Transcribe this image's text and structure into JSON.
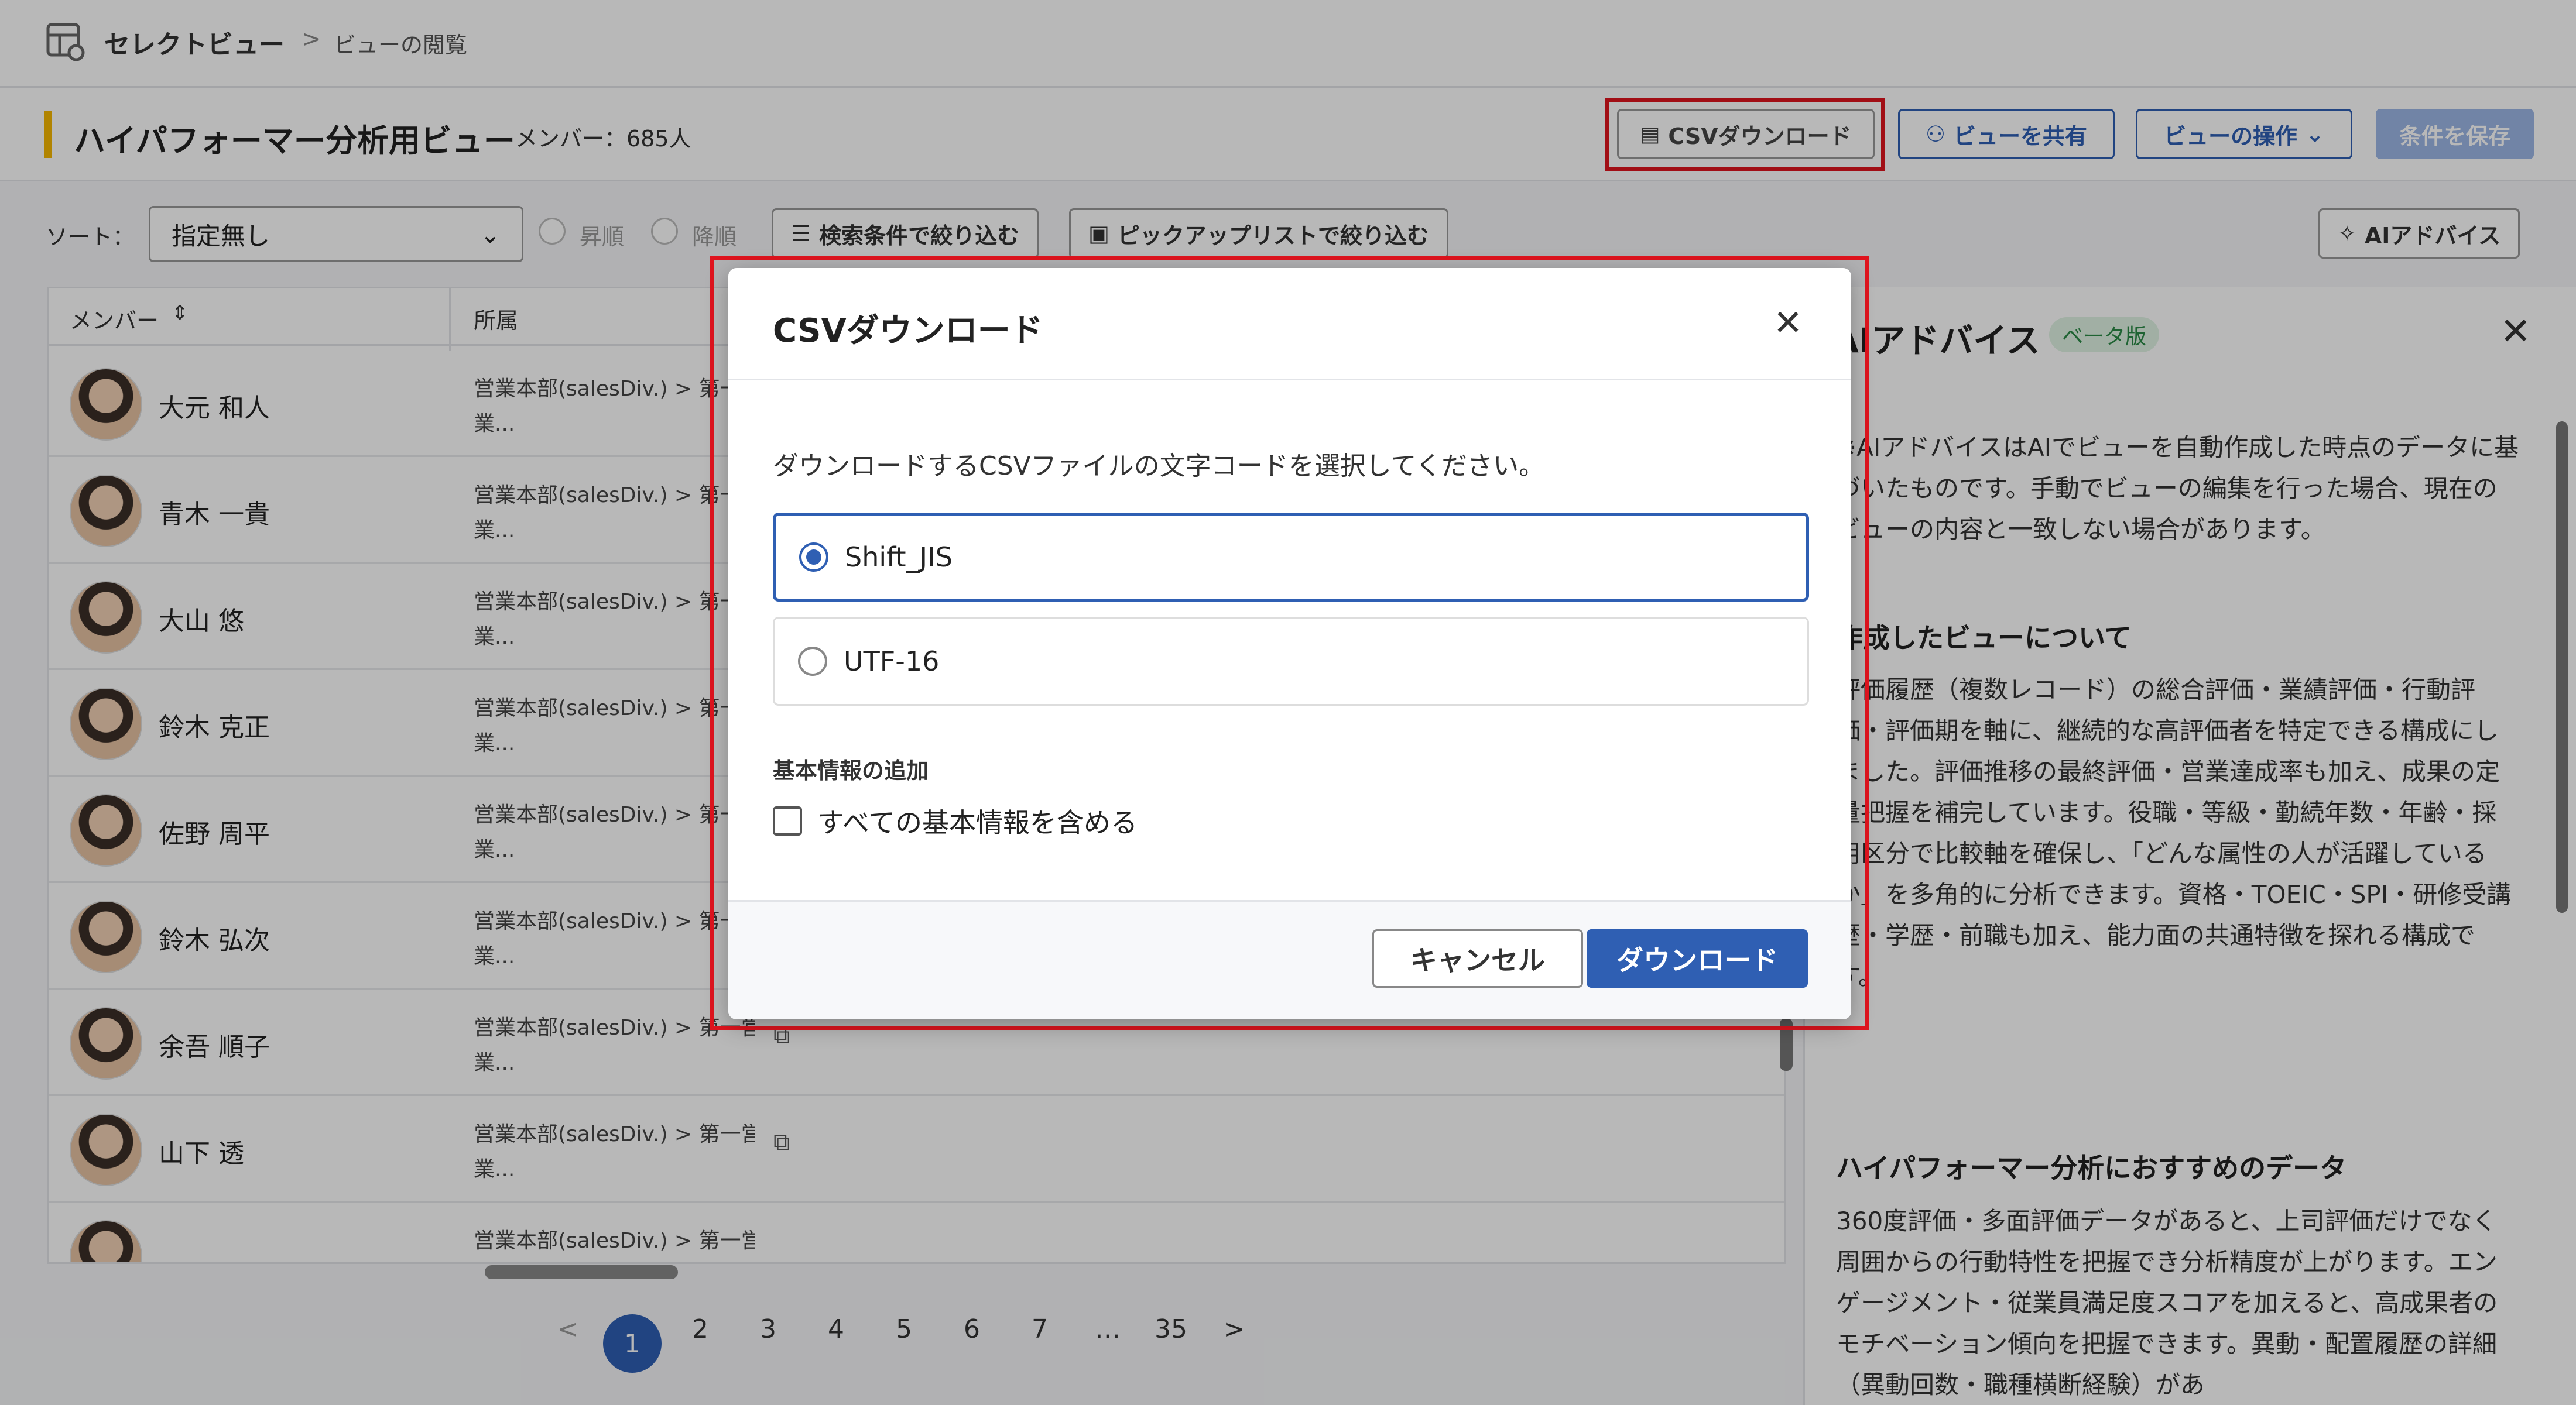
{
  "breadcrumb": {
    "app": "セレクトビュー",
    "separator": ">",
    "current": "ビューの閲覧"
  },
  "header": {
    "view_title": "ハイパフォーマー分析用ビュー",
    "member_count": "メンバー：685人",
    "csv_button": "CSVダウンロード",
    "share_button": "ビューを共有",
    "ops_button": "ビューの操作",
    "save_button": "条件を保存"
  },
  "toolbar": {
    "sort_label": "ソート：",
    "sort_value": "指定無し",
    "asc": "昇順",
    "desc": "降順",
    "filter_search": "検索条件で絞り込む",
    "filter_pickup": "ピックアップリストで絞り込む",
    "ai_button": "AIアドバイス"
  },
  "table": {
    "headers": [
      "メンバー",
      "所属"
    ],
    "rows": [
      {
        "name": "大元 和人",
        "dept1": "営業本部(salesDiv.) > 第一営",
        "dept2": "業..."
      },
      {
        "name": "青木 一貴",
        "dept1": "営業本部(salesDiv.) > 第一営",
        "dept2": "業..."
      },
      {
        "name": "大山 悠",
        "dept1": "営業本部(salesDiv.) > 第一営",
        "dept2": "業..."
      },
      {
        "name": "鈴木 克正",
        "dept1": "営業本部(salesDiv.) > 第一営",
        "dept2": "業..."
      },
      {
        "name": "佐野 周平",
        "dept1": "営業本部(salesDiv.) > 第一営",
        "dept2": "業..."
      },
      {
        "name": "鈴木 弘次",
        "dept1": "営業本部(salesDiv.) > 第一営",
        "dept2": "業..."
      },
      {
        "name": "余吾 順子",
        "dept1": "営業本部(salesDiv.) > 第一営",
        "dept2": "業..."
      },
      {
        "name": "山下 透",
        "dept1": "営業本部(salesDiv.) > 第一営",
        "dept2": "業..."
      },
      {
        "name": "",
        "dept1": "営業本部(salesDiv.) > 第一営",
        "dept2": ""
      }
    ]
  },
  "pager": {
    "pages": [
      "1",
      "2",
      "3",
      "4",
      "5",
      "6",
      "7",
      "…",
      "35"
    ],
    "current": "1",
    "prev": "<",
    "next": ">"
  },
  "ai_panel": {
    "title": "AIアドバイス",
    "badge": "ベータ版",
    "note": "※AIアドバイスはAIでビューを自動作成した時点のデータに基づいたものです。手動でビューの編集を行った場合、現在のビューの内容と一致しない場合があります。",
    "section1_title": "作成したビューについて",
    "section1_body": "評価履歴（複数レコード）の総合評価・業績評価・行動評価・評価期を軸に、継続的な高評価者を特定できる構成にしました。評価推移の最終評価・営業達成率も加え、成果の定量把握を補完しています。役職・等級・勤続年数・年齢・採用区分で比較軸を確保し、「どんな属性の人が活躍しているか」を多角的に分析できます。資格・TOEIC・SPI・研修受講歴・学歴・前職も加え、能力面の共通特徴を探れる構成です。",
    "section2_title": "ハイパフォーマー分析におすすめのデータ",
    "section2_body": "360度評価・多面評価データがあると、上司評価だけでなく周囲からの行動特性を把握でき分析精度が上がります。エンゲージメント・従業員満足度スコアを加えると、高成果者のモチベーション傾向を把握できます。異動・配置履歴の詳細（異動回数・職種横断経験）があ"
  },
  "modal": {
    "title": "CSVダウンロード",
    "description": "ダウンロードするCSVファイルの文字コードを選択してください。",
    "options": [
      "Shift_JIS",
      "UTF-16"
    ],
    "selected": "Shift_JIS",
    "section_label": "基本情報の追加",
    "checkbox_label": "すべての基本情報を含める",
    "cancel": "キャンセル",
    "download": "ダウンロード"
  },
  "colors": {
    "accent": "#2f5fb3",
    "highlight": "#e0141e",
    "bar": "#f5b800"
  }
}
